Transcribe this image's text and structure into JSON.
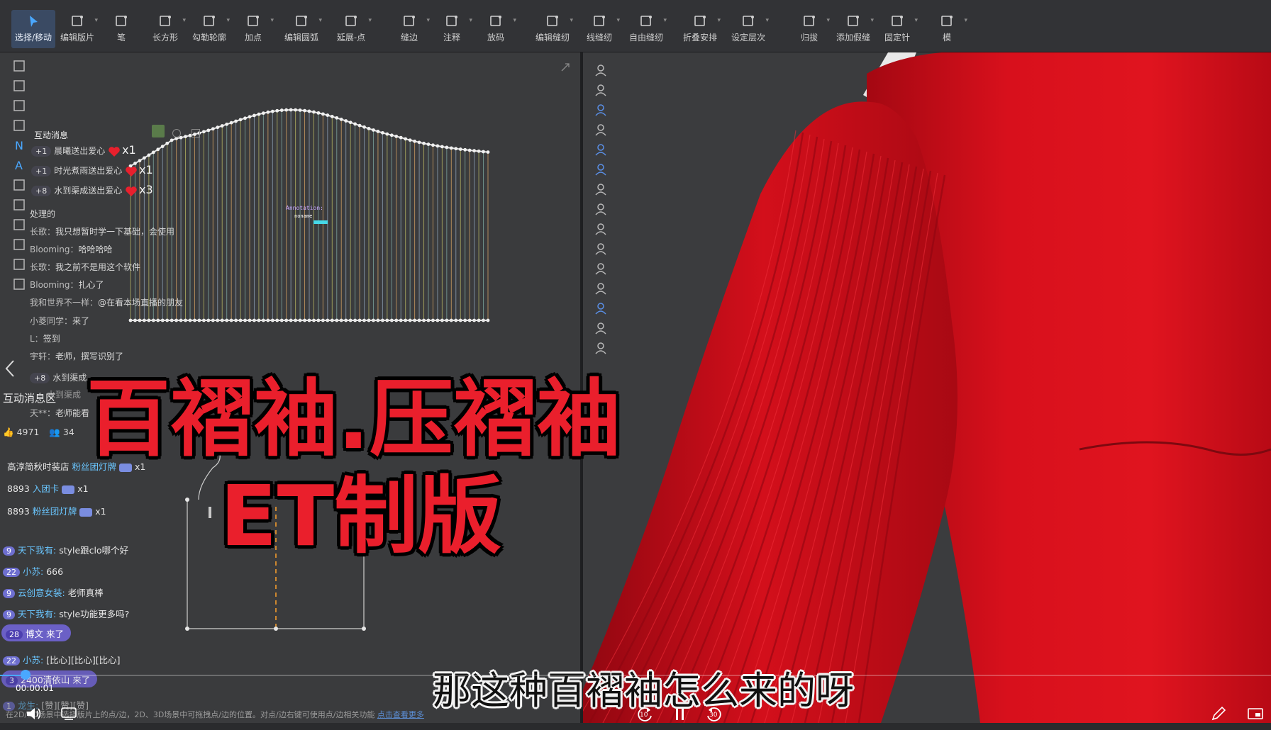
{
  "toolbar": {
    "tools": [
      {
        "label": "选择/移动",
        "icon": "cursor-icon"
      },
      {
        "label": "编辑版片",
        "icon": "edit-pattern-icon"
      },
      {
        "label": "笔",
        "icon": "pen-icon"
      },
      {
        "label": "长方形",
        "icon": "rectangle-icon"
      },
      {
        "label": "勾勒轮廓",
        "icon": "trace-icon"
      },
      {
        "label": "加点",
        "icon": "add-point-icon"
      },
      {
        "label": "编辑圆弧",
        "icon": "edit-curve-icon"
      },
      {
        "label": "延展-点",
        "icon": "extend-point-icon"
      },
      {
        "label": "缝边",
        "icon": "seam-allowance-icon"
      },
      {
        "label": "注释",
        "icon": "annotation-icon"
      },
      {
        "label": "放码",
        "icon": "grading-icon"
      },
      {
        "label": "编辑缝纫",
        "icon": "edit-sewing-icon"
      },
      {
        "label": "线缝纫",
        "icon": "segment-sewing-icon"
      },
      {
        "label": "自由缝纫",
        "icon": "free-sewing-icon"
      },
      {
        "label": "折叠安排",
        "icon": "fold-arrange-icon"
      },
      {
        "label": "设定层次",
        "icon": "layer-icon"
      },
      {
        "label": "归拔",
        "icon": "shrink-icon"
      },
      {
        "label": "添加假缝",
        "icon": "tack-icon"
      },
      {
        "label": "固定针",
        "icon": "pin-icon"
      },
      {
        "label": "模",
        "icon": "simulate-icon"
      }
    ]
  },
  "pattern": {
    "annotation_label": "Annotation:",
    "annotation_sub": "noname"
  },
  "chat": {
    "overlay_title": "互动消息",
    "gifts": [
      {
        "count": "+1",
        "text": "晨曦送出爱心",
        "mult": "x1"
      },
      {
        "count": "+1",
        "text": "时光煮雨送出爱心",
        "mult": "x1"
      },
      {
        "count": "+8",
        "text": "水到渠成送出爱心",
        "mult": "x3"
      }
    ],
    "lines": [
      {
        "name": "",
        "text": "处理的"
      },
      {
        "name": "长歌：",
        "text": "我只想暂时学一下基础，会使用"
      },
      {
        "name": "Blooming：",
        "text": "哈哈哈哈"
      },
      {
        "name": "长歌：",
        "text": "我之前不是用这个软件"
      },
      {
        "name": "Blooming：",
        "text": "扎心了"
      },
      {
        "name": "我和世界不一样：",
        "text": "@在看本场直播的朋友"
      },
      {
        "name": "小菱同学：",
        "text": "来了"
      },
      {
        "name": "L：",
        "text": "签到"
      },
      {
        "name": "宇轩：",
        "text": "老师，撰写识别了"
      }
    ],
    "gift_again": {
      "count": "+8",
      "text": "水到渠成",
      "mult": ""
    },
    "gift_again2": "水到渠成",
    "teacher_line": {
      "name": "天**：",
      "text": "老师能看"
    },
    "section_title": "互动消息区",
    "likes": "4971",
    "viewers": "34",
    "fan_gifts": [
      {
        "name": "高淳简秋时装店",
        "item": "粉丝团灯牌",
        "mult": "x1"
      },
      {
        "name": "8893",
        "item": "入团卡",
        "mult": "x1"
      },
      {
        "name": "8893",
        "item": "粉丝团灯牌",
        "mult": "x1"
      }
    ],
    "messages": [
      {
        "level": "9",
        "name": "天下我有:",
        "text": "style跟clo哪个好"
      },
      {
        "level": "22",
        "name": "小苏:",
        "text": "666"
      },
      {
        "level": "9",
        "name": "云创意女装:",
        "text": "老师真棒"
      },
      {
        "level": "9",
        "name": "天下我有:",
        "text": "style功能更多吗?"
      }
    ],
    "joined": {
      "level": "28",
      "text": "博文 来了"
    },
    "msg_after": {
      "level": "22",
      "name": "小苏:",
      "text": "[比心][比心][比心]"
    },
    "joined2": {
      "level": "3",
      "text": "2400清依山 来了"
    },
    "last_msg": {
      "level": "1",
      "name": "龙生:",
      "text": "[赞][赞][赞]"
    }
  },
  "overlay": {
    "title_line1": "百褶袖.压褶袖",
    "title_line2": "ET制版"
  },
  "subtitle": "那这种百褶袖怎么来的呀",
  "player": {
    "time": "00:00:01",
    "skip_back": "10",
    "skip_forward": "30",
    "hint": "在2D/3D场景中选择版片上的点/边，2D、3D场景中可拖拽点/边的位置。对点/边右键可使用点/边相关功能",
    "hint_link": "点击查看更多",
    "progress_fraction": 0.02
  },
  "colors": {
    "accent": "#4aa8ff",
    "title_red": "#ea1f2c",
    "sweater_red": "#d8101c"
  }
}
